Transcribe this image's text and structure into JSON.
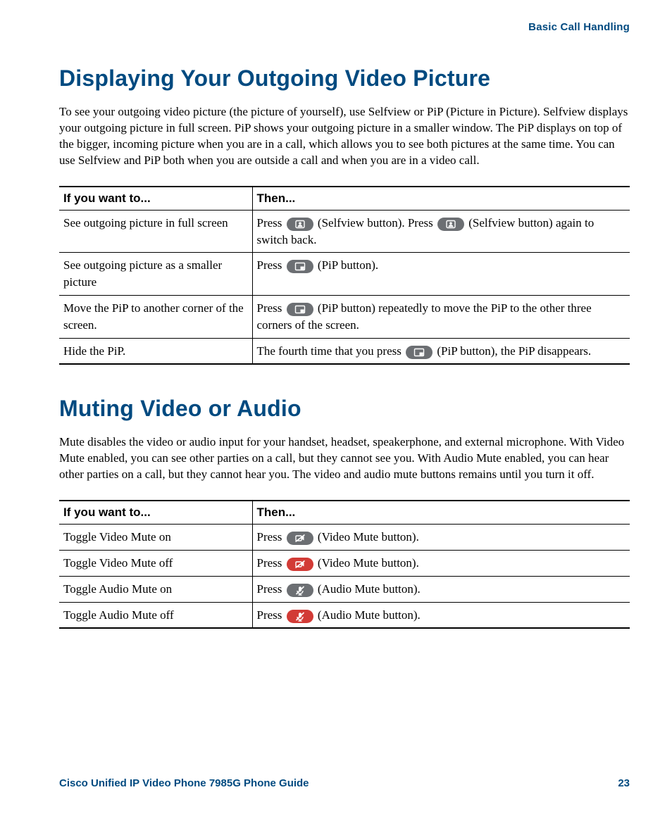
{
  "header": {
    "section_title": "Basic Call Handling"
  },
  "footer": {
    "guide_title": "Cisco Unified IP Video Phone 7985G Phone Guide",
    "page_number": "23"
  },
  "icons": {
    "selfview": "selfview",
    "pip": "pip",
    "video_mute": "video-mute",
    "video_mute_red": "video-mute-red",
    "audio_mute": "audio-mute",
    "audio_mute_red": "audio-mute-red"
  },
  "section1": {
    "heading": "Displaying Your Outgoing Video Picture",
    "paragraph": "To see your outgoing video picture (the picture of yourself), use Selfview or PiP (Picture in Picture). Selfview displays your outgoing picture in full screen. PiP shows your outgoing picture in a smaller window. The PiP displays on top of the bigger, incoming picture when you are in a call, which allows you to see both pictures at the same time. You can use Selfview and PiP both when you are outside a call and when you are in a video call.",
    "table": {
      "headers": {
        "col1": "If you want to...",
        "col2": "Then..."
      },
      "rows": [
        {
          "c1": "See outgoing picture in full screen",
          "c2_parts": [
            {
              "t": "Press "
            },
            {
              "icon": "selfview"
            },
            {
              "t": " (Selfview button). Press "
            },
            {
              "icon": "selfview"
            },
            {
              "t": " (Selfview button) again to switch back."
            }
          ]
        },
        {
          "c1": "See outgoing picture as a smaller picture",
          "c2_parts": [
            {
              "t": "Press "
            },
            {
              "icon": "pip"
            },
            {
              "t": " (PiP button)."
            }
          ]
        },
        {
          "c1": "Move the PiP to another corner of the screen.",
          "c2_parts": [
            {
              "t": "Press "
            },
            {
              "icon": "pip"
            },
            {
              "t": " (PiP button) repeatedly to move the PiP to the other three corners of the screen."
            }
          ]
        },
        {
          "c1": "Hide the PiP.",
          "c2_parts": [
            {
              "t": "The fourth time that you press "
            },
            {
              "icon": "pip"
            },
            {
              "t": " (PiP button), the PiP disappears."
            }
          ]
        }
      ]
    }
  },
  "section2": {
    "heading": "Muting Video or Audio",
    "paragraph": "Mute disables the video or audio input for your handset, headset, speakerphone, and external microphone. With Video Mute enabled, you can see other parties on a call, but they cannot see you. With Audio Mute enabled, you can hear other parties on a call, but they cannot hear you. The video and audio mute buttons remains until you turn it off.",
    "table": {
      "headers": {
        "col1": "If you want to...",
        "col2": "Then..."
      },
      "rows": [
        {
          "c1": "Toggle Video Mute on",
          "c2_parts": [
            {
              "t": "Press "
            },
            {
              "icon": "video_mute"
            },
            {
              "t": " (Video Mute button)."
            }
          ]
        },
        {
          "c1": "Toggle Video Mute off",
          "c2_parts": [
            {
              "t": "Press "
            },
            {
              "icon": "video_mute_red"
            },
            {
              "t": " (Video Mute button)."
            }
          ]
        },
        {
          "c1": "Toggle Audio Mute on",
          "c2_parts": [
            {
              "t": "Press "
            },
            {
              "icon": "audio_mute"
            },
            {
              "t": " (Audio Mute button)."
            }
          ]
        },
        {
          "c1": "Toggle Audio Mute off",
          "c2_parts": [
            {
              "t": "Press "
            },
            {
              "icon": "audio_mute_red"
            },
            {
              "t": " (Audio Mute button)."
            }
          ]
        }
      ]
    }
  }
}
